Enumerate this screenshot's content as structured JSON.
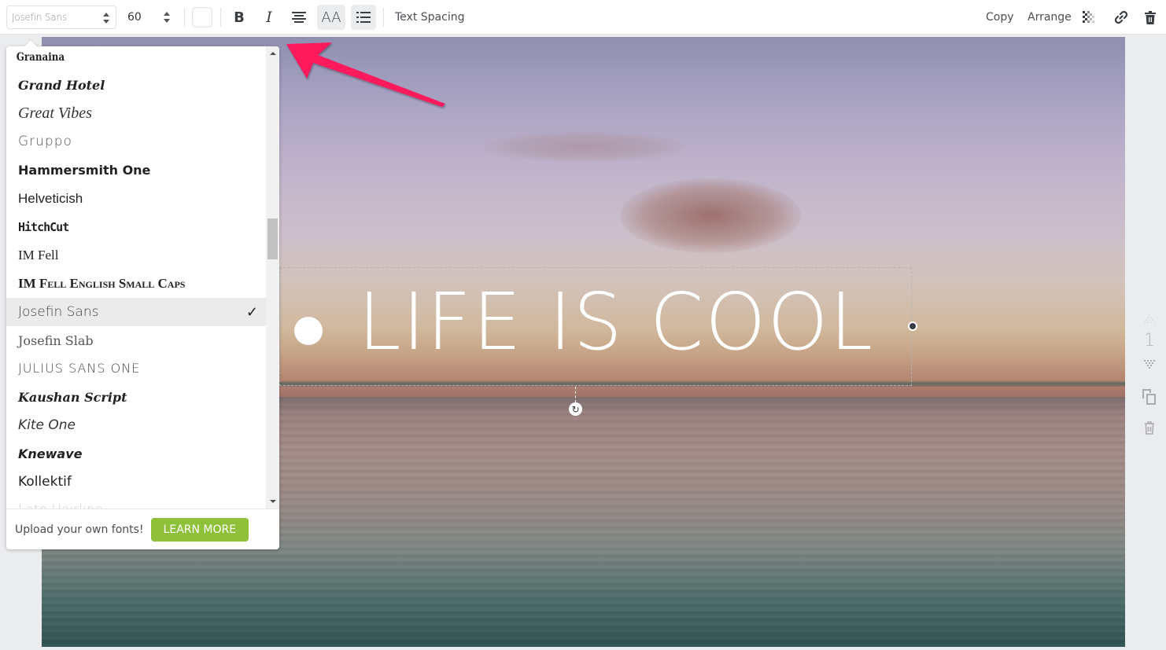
{
  "toolbar": {
    "font_family": "Josefin Sans",
    "font_size": "60",
    "text_color": "#ffffff",
    "bold_icon": "bold-icon",
    "italic_icon": "italic-icon",
    "align_icon": "align-center-icon",
    "case_label": "AA",
    "list_icon": "bullet-list-icon",
    "text_spacing_label": "Text Spacing",
    "copy_label": "Copy",
    "arrange_label": "Arrange",
    "transparency_icon": "transparency-icon",
    "link_icon": "link-icon",
    "delete_icon": "trash-icon"
  },
  "font_dropdown": {
    "items": [
      {
        "label": "Granaina",
        "selected": false
      },
      {
        "label": "Grand Hotel",
        "selected": false
      },
      {
        "label": "Great Vibes",
        "selected": false
      },
      {
        "label": "Gruppo",
        "selected": false
      },
      {
        "label": "Hammersmith One",
        "selected": false
      },
      {
        "label": "Helveticish",
        "selected": false
      },
      {
        "label": "HitchCut",
        "selected": false
      },
      {
        "label": "IM Fell",
        "selected": false
      },
      {
        "label": "IM Fell English Small Caps",
        "selected": false
      },
      {
        "label": "Josefin Sans",
        "selected": true
      },
      {
        "label": "Josefin Slab",
        "selected": false
      },
      {
        "label": "Julius Sans One",
        "selected": false
      },
      {
        "label": "Kaushan Script",
        "selected": false
      },
      {
        "label": "Kite One",
        "selected": false
      },
      {
        "label": "Knewave",
        "selected": false
      },
      {
        "label": "Kollektif",
        "selected": false
      },
      {
        "label": "Lato Hairline",
        "selected": false
      }
    ],
    "check_mark": "✓",
    "footer_message": "Upload your own fonts!",
    "learn_more_label": "LEARN MORE",
    "accent_color": "#8fc03a"
  },
  "canvas": {
    "headline": "LIFE IS COOL",
    "annotation_arrow_color": "#ff1a5e"
  },
  "page_rail": {
    "page_number": "1",
    "move_up_icon": "move-page-up-icon",
    "move_down_icon": "move-page-down-icon",
    "duplicate_icon": "duplicate-page-icon",
    "delete_icon": "delete-page-icon"
  }
}
